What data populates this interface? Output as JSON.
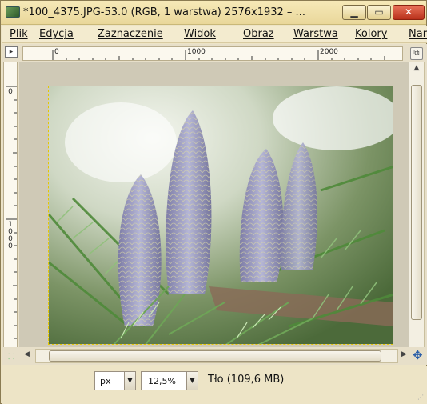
{
  "window": {
    "title": "*100_4375.JPG-53.0 (RGB, 1 warstwa) 2576x1932 – ...",
    "controls": {
      "minimize": "minimize-icon",
      "maximize": "maximize-icon",
      "close": "close-icon"
    }
  },
  "menubar": {
    "items": [
      {
        "label": "Plik"
      },
      {
        "label": "Edycja"
      },
      {
        "label": "Zaznaczenie"
      },
      {
        "label": "Widok"
      },
      {
        "label": "Obraz"
      },
      {
        "label": "Warstwa"
      },
      {
        "label": "Kolory"
      },
      {
        "label": "Nar"
      }
    ]
  },
  "rulers": {
    "horizontal_labels": [
      "0",
      "1000",
      "2000"
    ],
    "vertical_labels": [
      "0",
      "1000"
    ]
  },
  "canvas": {
    "image_subject": "fir-cones-photo",
    "selection_color": "#e6c800"
  },
  "statusbar": {
    "unit": "px",
    "zoom": "12,5%",
    "layer_info": "Tło (109,6 MB)"
  },
  "colors": {
    "title_bg": "#f3e6b2",
    "window_bg": "#ede4c6",
    "close_button": "#c8432a"
  }
}
